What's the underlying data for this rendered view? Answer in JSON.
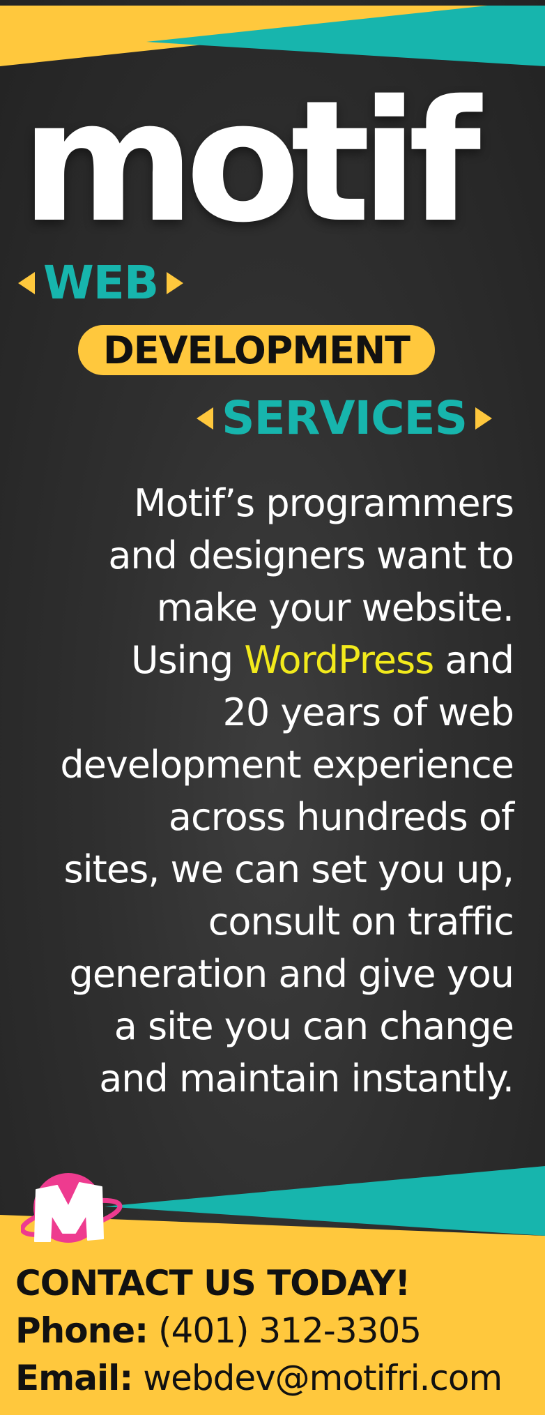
{
  "brand": {
    "wordmark": "motif",
    "logo_icon": "m-logo-icon"
  },
  "tagline": {
    "line1": "WEB",
    "line2": "DEVELOPMENT",
    "line3": "SERVICES"
  },
  "body": {
    "lines": [
      {
        "text": "Motif’s programmers"
      },
      {
        "text": "and designers want to"
      },
      {
        "text": "make your website."
      },
      {
        "before": "Using ",
        "accent": "WordPress",
        "after": " and"
      },
      {
        "text": "20 years of web"
      },
      {
        "text": "development experience"
      },
      {
        "text": "across hundreds of"
      },
      {
        "text": "sites, we can set you up,"
      },
      {
        "text": "consult on traffic"
      },
      {
        "text": "generation and give you"
      },
      {
        "text": "a site you can change"
      },
      {
        "text": "and maintain instantly."
      }
    ]
  },
  "contact": {
    "heading": "CONTACT US TODAY!",
    "phone_label": "Phone:",
    "phone": "(401) 312-3305",
    "email_label": "Email:",
    "email": "webdev@motifri.com"
  },
  "colors": {
    "background": "#2f2f2f",
    "yellow": "#ffc83d",
    "teal": "#17b5ad",
    "accent_text": "#f2ea1c",
    "logo_pink": "#ee3b8f"
  }
}
